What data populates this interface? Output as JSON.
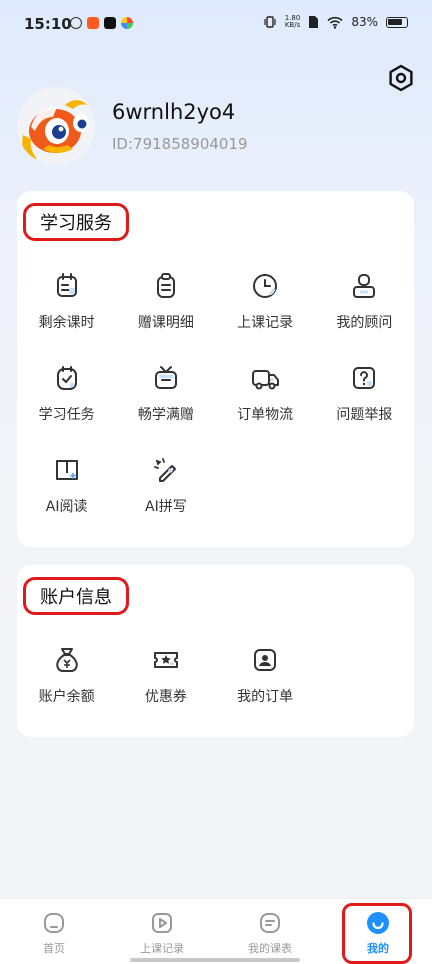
{
  "status_bar": {
    "time": "15:10",
    "net_speed_value": "1.80",
    "net_speed_unit": "KB/s",
    "battery": "83%"
  },
  "profile": {
    "username": "6wrnlh2yo4",
    "user_id": "ID:791858904019"
  },
  "study_services": {
    "title": "学习服务",
    "items": [
      {
        "label": "剩余课时",
        "icon": "calendar-icon"
      },
      {
        "label": "赠课明细",
        "icon": "clipboard-icon"
      },
      {
        "label": "上课记录",
        "icon": "clock-icon"
      },
      {
        "label": "我的顾问",
        "icon": "advisor-icon"
      },
      {
        "label": "学习任务",
        "icon": "task-check-icon"
      },
      {
        "label": "畅学满赠",
        "icon": "gift-tv-icon"
      },
      {
        "label": "订单物流",
        "icon": "truck-icon"
      },
      {
        "label": "问题举报",
        "icon": "question-icon"
      },
      {
        "label": "AI阅读",
        "icon": "ai-book-icon"
      },
      {
        "label": "AI拼写",
        "icon": "ai-pen-icon"
      }
    ]
  },
  "account_info": {
    "title": "账户信息",
    "items": [
      {
        "label": "账户余额",
        "icon": "money-bag-icon"
      },
      {
        "label": "优惠券",
        "icon": "coupon-icon"
      },
      {
        "label": "我的订单",
        "icon": "order-icon"
      }
    ]
  },
  "bottom_nav": {
    "items": [
      {
        "label": "首页",
        "icon": "home-icon"
      },
      {
        "label": "上课记录",
        "icon": "play-icon"
      },
      {
        "label": "我的课表",
        "icon": "schedule-icon"
      },
      {
        "label": "我的",
        "icon": "mine-icon"
      }
    ],
    "active_index": 3
  },
  "colors": {
    "accent": "#1e90ff",
    "highlight_border": "#e01a1a",
    "icon_stroke": "#333333",
    "icon_fill": "#c9e1f5"
  }
}
